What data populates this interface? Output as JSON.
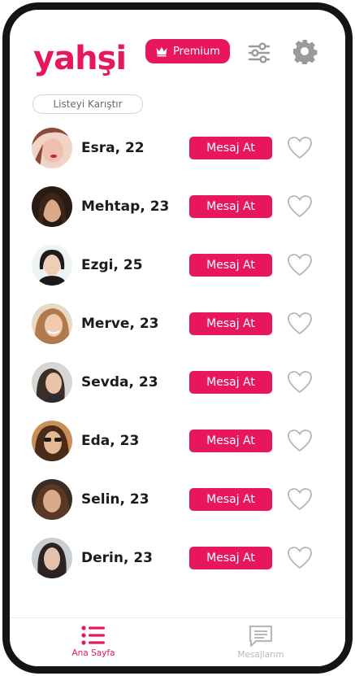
{
  "header": {
    "logo": "yahşi",
    "premium_label": "Premium",
    "filter_icon": "sliders-icon",
    "settings_icon": "gear-icon"
  },
  "shuffle_label": "Listeyi Karıştır",
  "profiles": [
    {
      "name": "Esra, 22",
      "action": "Mesaj At"
    },
    {
      "name": "Mehtap, 23",
      "action": "Mesaj At"
    },
    {
      "name": "Ezgi, 25",
      "action": "Mesaj At"
    },
    {
      "name": "Merve, 23",
      "action": "Mesaj At"
    },
    {
      "name": "Sevda, 23",
      "action": "Mesaj At"
    },
    {
      "name": "Eda, 23",
      "action": "Mesaj At"
    },
    {
      "name": "Selin, 23",
      "action": "Mesaj At"
    },
    {
      "name": "Derin, 23",
      "action": "Mesaj At"
    }
  ],
  "tabs": [
    {
      "label": "Ana Sayfa",
      "icon": "list-icon",
      "active": true
    },
    {
      "label": "Mesajlarım",
      "icon": "message-icon",
      "active": false
    }
  ],
  "colors": {
    "accent": "#e8175d",
    "inactive": "#b9b9b9",
    "frame": "#141414"
  }
}
